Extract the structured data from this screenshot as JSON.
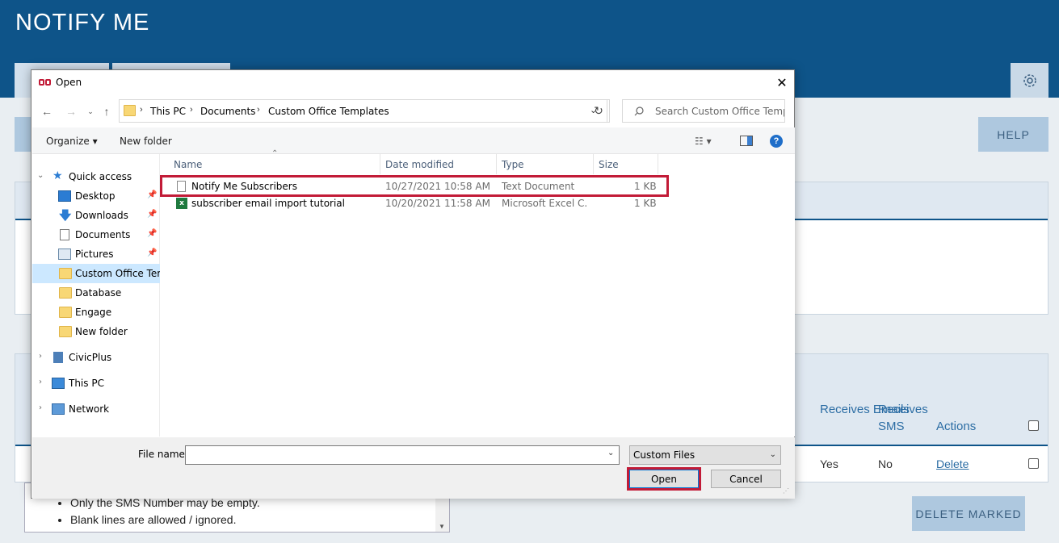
{
  "app": {
    "title": "NOTIFY ME",
    "help_label": "HELP",
    "delete_marked_label": "DELETE MARKED",
    "table": {
      "headers": {
        "receives_emails": "Receives Emails",
        "receives_sms": "Receives SMS",
        "actions": "Actions"
      },
      "row": {
        "receives_emails": "Yes",
        "receives_sms": "No",
        "action": "Delete"
      }
    },
    "instructions": [
      "Only the SMS Number may be empty.",
      "Blank lines are allowed / ignored."
    ]
  },
  "dialog": {
    "title": "Open",
    "breadcrumb": [
      "This PC",
      "Documents",
      "Custom Office Templates"
    ],
    "search_placeholder": "Search Custom Office Templ...",
    "toolbar": {
      "organize": "Organize",
      "new_folder": "New folder"
    },
    "nav": {
      "quick_access": "Quick access",
      "items": [
        {
          "label": "Desktop",
          "pinned": true,
          "icon": "desktop-icon"
        },
        {
          "label": "Downloads",
          "pinned": true,
          "icon": "download-icon"
        },
        {
          "label": "Documents",
          "pinned": true,
          "icon": "document-icon"
        },
        {
          "label": "Pictures",
          "pinned": true,
          "icon": "picture-icon"
        },
        {
          "label": "Custom Office Tem",
          "pinned": false,
          "icon": "folder-icon",
          "selected": true
        },
        {
          "label": "Database",
          "pinned": false,
          "icon": "folder-icon"
        },
        {
          "label": "Engage",
          "pinned": false,
          "icon": "folder-icon"
        },
        {
          "label": "New folder",
          "pinned": false,
          "icon": "folder-icon"
        }
      ],
      "civicplus": "CivicPlus",
      "this_pc": "This PC",
      "network": "Network"
    },
    "columns": {
      "name": "Name",
      "date": "Date modified",
      "type": "Type",
      "size": "Size"
    },
    "files": [
      {
        "name": "Notify Me Subscribers",
        "date": "10/27/2021 10:58 AM",
        "type": "Text Document",
        "size": "1 KB",
        "icon": "text-file-icon"
      },
      {
        "name": "subscriber email import tutorial",
        "date": "10/20/2021 11:58 AM",
        "type": "Microsoft Excel C...",
        "size": "1 KB",
        "icon": "excel-file-icon"
      }
    ],
    "file_name_label": "File name:",
    "file_name_value": "",
    "file_type": "Custom Files",
    "open_label": "Open",
    "cancel_label": "Cancel"
  },
  "colors": {
    "header_blue": "#0e5489",
    "highlight_red": "#c21b37",
    "nav_selected": "#cce8ff"
  }
}
